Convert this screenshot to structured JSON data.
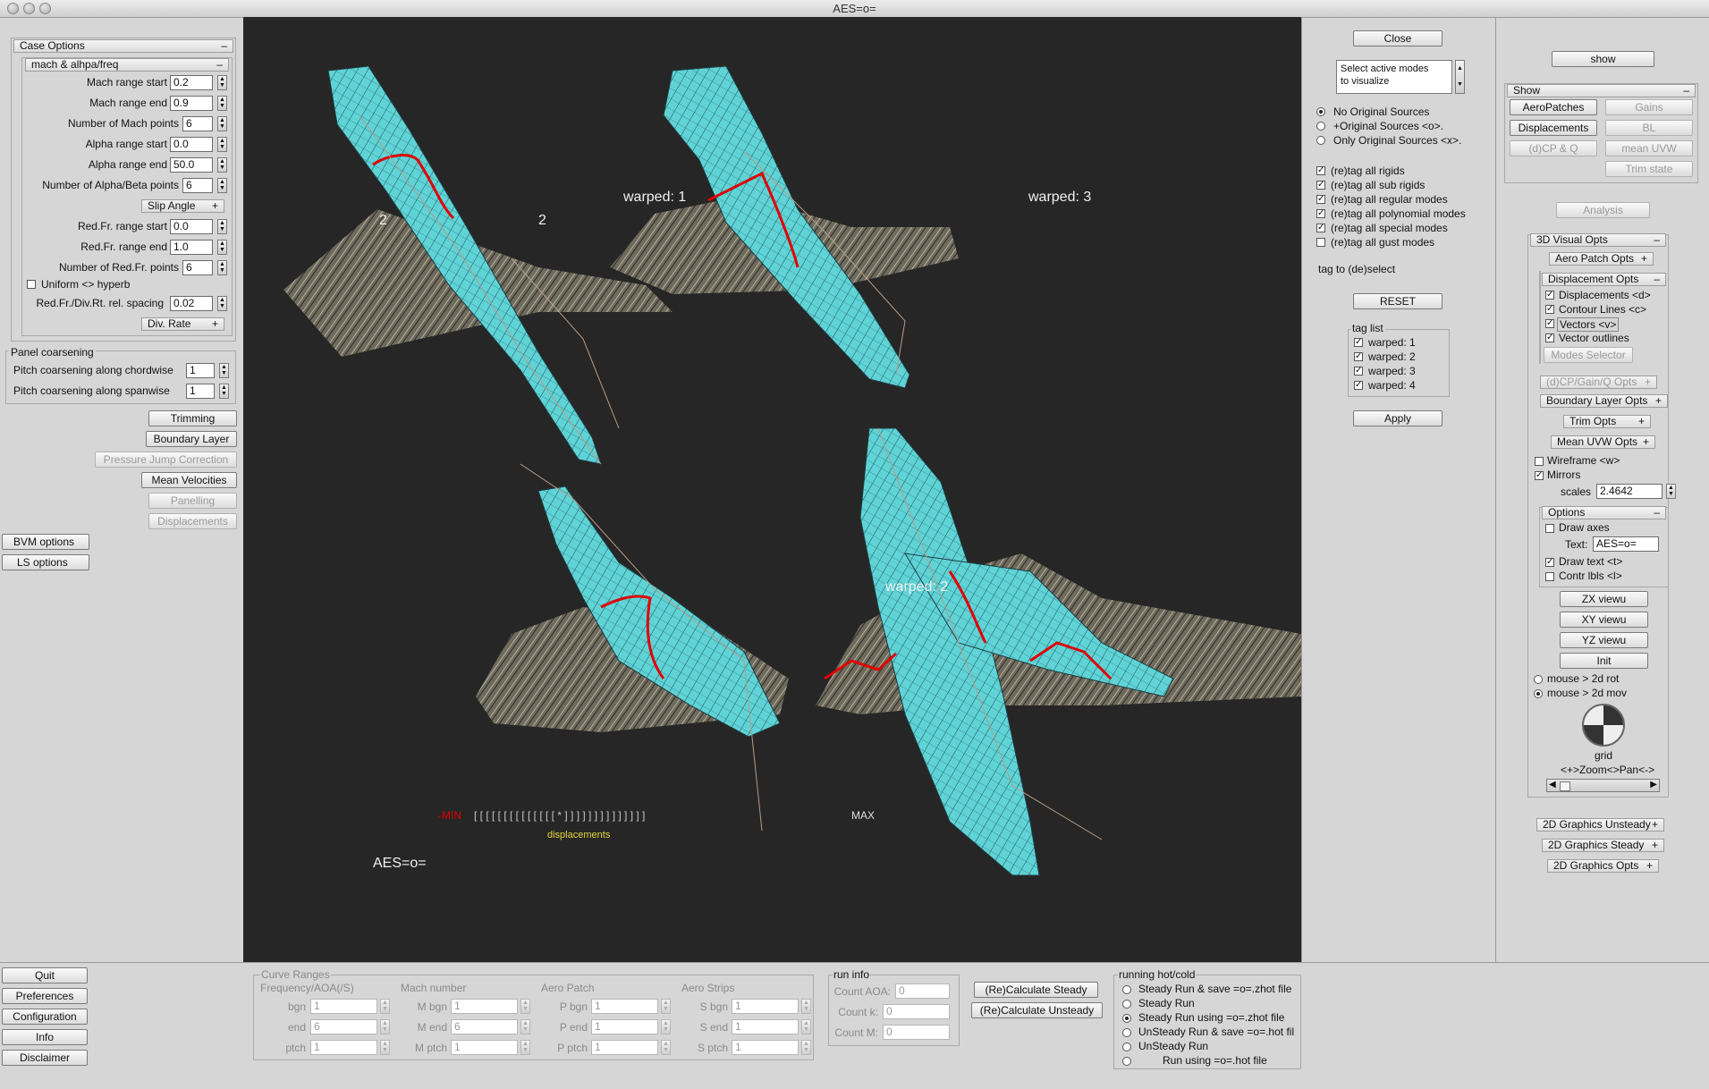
{
  "window": {
    "title": "AES=o="
  },
  "case_options": {
    "header": "Case Options",
    "mach_header": "mach & alhpa/freq",
    "fields": [
      {
        "label": "Mach range start",
        "value": "0.2"
      },
      {
        "label": "Mach range end",
        "value": "0.9"
      },
      {
        "label": "Number of Mach points",
        "value": "6"
      },
      {
        "label": "Alpha range start",
        "value": "0.0"
      },
      {
        "label": "Alpha range end",
        "value": "50.0"
      },
      {
        "label": "Number of Alpha/Beta points",
        "value": "6"
      }
    ],
    "slip_angle": "Slip Angle",
    "fields2": [
      {
        "label": "Red.Fr. range start",
        "value": "0.0"
      },
      {
        "label": "Red.Fr. range end",
        "value": "1.0"
      },
      {
        "label": "Number of Red.Fr. points",
        "value": "6"
      }
    ],
    "uniform_hyperb": "Uniform <> hyperb",
    "spacing_label": "Red.Fr./Div.Rt. rel. spacing",
    "spacing_value": "0.02",
    "div_rate": "Div. Rate"
  },
  "panel_coarsening": {
    "title": "Panel coarsening",
    "chordwise_label": "Pitch coarsening along chordwise",
    "chordwise_value": "1",
    "spanwise_label": "Pitch coarsening along  spanwise",
    "spanwise_value": "1"
  },
  "left_buttons": [
    "Trimming",
    "Boundary Layer",
    "Pressure Jump Correction",
    "Mean Velocities",
    "Panelling",
    "Displacements"
  ],
  "left_option_buttons": [
    "BVM options",
    "LS  options"
  ],
  "bottom_left_buttons": [
    "Quit",
    "Preferences",
    "Configuration",
    "Info",
    "Disclaimer"
  ],
  "viewport": {
    "labels": [
      "warped:  1",
      "warped:  3",
      "warped:  2",
      "2",
      "2"
    ],
    "scale_min": "-MIN",
    "scale_ticks": "[ [ [ [ [ [ [ [ [ [ [ [ [ [ *  ] ] ] ] ] ] ] ] ] ] ] ] ] ]",
    "scale_max": "MAX",
    "scale_caption": "displacements",
    "text": "AES=o="
  },
  "mode_panel": {
    "close": "Close",
    "select_text": "Select active modes\nto visualize",
    "sources": [
      "No Original Sources",
      "+Original Sources <o>.",
      "Only Original Sources <x>."
    ],
    "retag": [
      "(re)tag all rigids",
      "(re)tag all sub rigids",
      "(re)tag all regular modes",
      "(re)tag all polynomial modes",
      "(re)tag all special modes",
      "(re)tag all gust modes"
    ],
    "retag_checked": [
      true,
      true,
      true,
      true,
      true,
      false
    ],
    "tag_hint": "tag to (de)select",
    "reset": "RESET",
    "tag_list_title": "tag list",
    "tag_list": [
      "warped:  1",
      "warped:  2",
      "warped:  3",
      "warped:  4"
    ],
    "apply": "Apply"
  },
  "right_panel": {
    "show_button": "show",
    "show_header": "Show",
    "show_buttons": [
      "AeroPatches",
      "Displacements",
      "(d)CP & Q"
    ],
    "show_buttons_dim": [
      "Gains",
      "BL",
      "mean UVW",
      "Trim state"
    ],
    "analysis": "Analysis",
    "visual_opts": "3D Visual Opts",
    "aero_patch_opts": "Aero Patch Opts",
    "displacement_opts": "Displacement  Opts",
    "disp_checks": [
      "Displacements <d>",
      "Contour Lines <c>",
      "Vectors <v>",
      "Vector outlines"
    ],
    "modes_selector": "Modes Selector",
    "cp_gain_opts": "(d)CP/Gain/Q  Opts",
    "bl_opts": "Boundary Layer Opts",
    "trim_opts": "Trim  Opts",
    "uvw_opts": "Mean UVW Opts",
    "wireframe": "Wireframe <w>",
    "mirrors": "Mirrors",
    "scales_label": "scales",
    "scales_value": "2.4642",
    "options_header": "Options",
    "draw_axes": "Draw axes",
    "text_label": "Text:",
    "text_value": "AES=o=",
    "draw_text": "Draw  text <t>",
    "contr_lbls": "Contr lbls <l>",
    "view_buttons": [
      "ZX viewu",
      "XY viewu",
      "YZ viewu",
      "Init"
    ],
    "mouse_modes": [
      "mouse > 2d rot",
      "mouse > 2d mov"
    ],
    "grid_label": "grid",
    "zoom_pan": "<+>Zoom<>Pan<->",
    "graphics_2d": [
      "2D Graphics Unsteady",
      "2D Graphics Steady",
      "2D Graphics Opts"
    ]
  },
  "curve_ranges": {
    "title": "Curve Ranges",
    "columns": [
      "Frequency/AOA(/S)",
      "Mach number",
      "Aero Patch",
      "Aero Strips"
    ],
    "rows": [
      {
        "labels": [
          "bgn",
          "M bgn",
          "P bgn",
          "S bgn"
        ],
        "values": [
          "1",
          "1",
          "1",
          "1"
        ]
      },
      {
        "labels": [
          "end",
          "M end",
          "P end",
          "S end"
        ],
        "values": [
          "6",
          "6",
          "1",
          "1"
        ]
      },
      {
        "labels": [
          "ptch",
          "M ptch",
          "P ptch",
          "S ptch"
        ],
        "values": [
          "1",
          "1",
          "1",
          "1"
        ]
      }
    ]
  },
  "run_info": {
    "title": "run info",
    "fields": [
      {
        "label": "Count AOA:",
        "value": "0"
      },
      {
        "label": "Count k:",
        "value": "0"
      },
      {
        "label": "Count M:",
        "value": "0"
      }
    ]
  },
  "calc_buttons": [
    "(Re)Calculate Steady",
    "(Re)Calculate Unsteady"
  ],
  "running": {
    "title": "running hot/cold",
    "options": [
      "Steady Run & save =o=.zhot file",
      "Steady Run",
      "Steady Run  using =o=.zhot file",
      "UnSteady Run & save =o=.hot fil",
      "UnSteady Run",
      "Run  using =o=.hot file"
    ],
    "selected": 2
  },
  "colors": {
    "viewport_bg": "#262626",
    "surface": "#5fd3d6",
    "wake": "#8a8470",
    "highlight": "#e00000"
  }
}
